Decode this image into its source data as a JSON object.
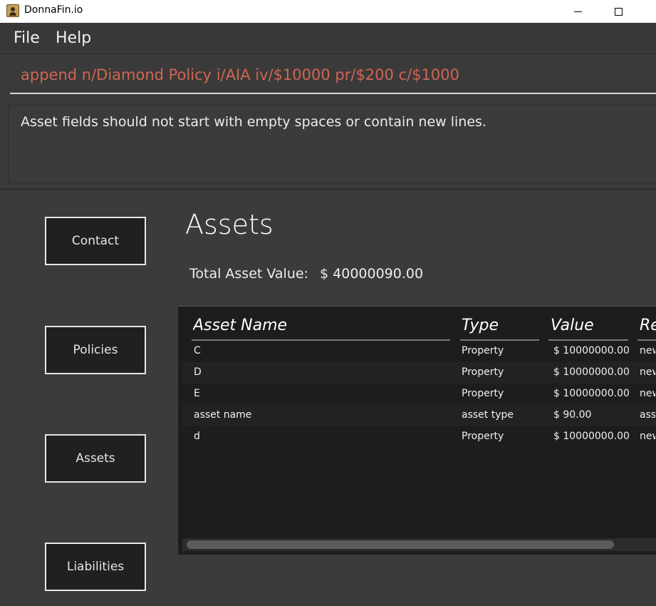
{
  "window": {
    "title": "DonnaFin.io"
  },
  "menu": {
    "items": [
      "File",
      "Help"
    ]
  },
  "command": {
    "value": "append n/Diamond Policy i/AIA iv/$10000 pr/$200 c/$1000"
  },
  "result": {
    "message": "Asset fields should not start with empty spaces or contain new lines."
  },
  "nav": {
    "contact": "Contact",
    "policies": "Policies",
    "assets": "Assets",
    "liabilities": "Liabilities"
  },
  "page": {
    "title": "Assets",
    "total_label": "Total Asset Value:",
    "total_value": "$ 40000090.00"
  },
  "table": {
    "headers": [
      "Asset Name",
      "Type",
      "Value",
      "Remarks"
    ],
    "rows": [
      [
        "C",
        "Property",
        "$ 10000000.00",
        "new"
      ],
      [
        "D",
        "Property",
        "$ 10000000.00",
        "new"
      ],
      [
        "E",
        "Property",
        "$ 10000000.00",
        "new"
      ],
      [
        "asset name",
        "asset type",
        "$ 90.00",
        "asset"
      ],
      [
        "d",
        "Property",
        "$ 10000000.00",
        "new"
      ]
    ]
  },
  "colors": {
    "command_text": "#d06651",
    "background": "#3b3b3b",
    "table_bg": "#1d1d1d"
  }
}
